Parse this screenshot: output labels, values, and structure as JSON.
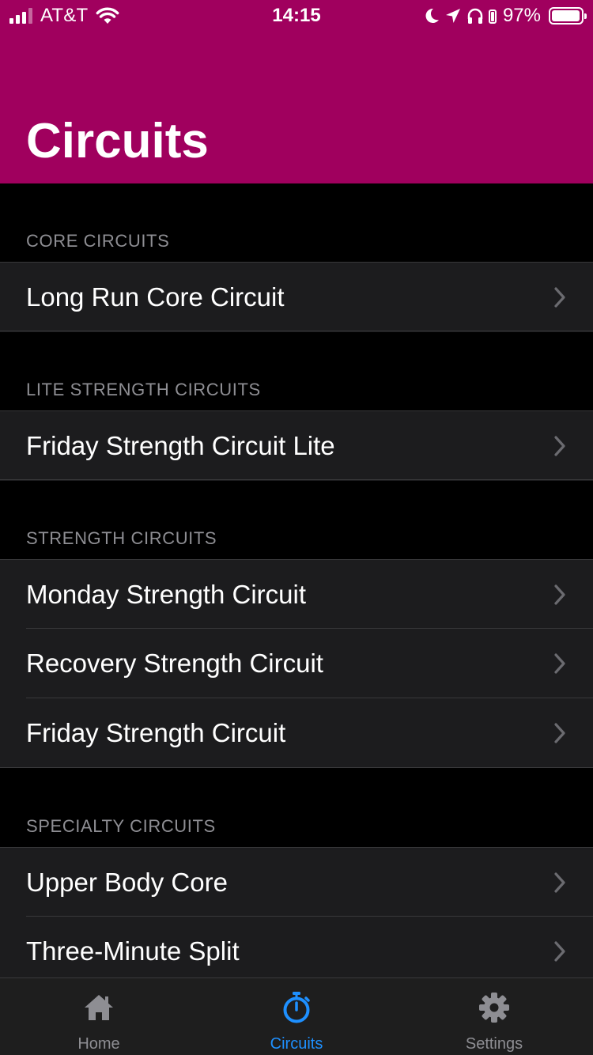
{
  "status_bar": {
    "carrier": "AT&T",
    "time": "14:15",
    "battery_percent": "97%",
    "battery_level": 0.97,
    "icons": [
      "signal-icon",
      "wifi-icon",
      "moon-icon",
      "location-arrow-icon",
      "headphones-icon",
      "battery-icon"
    ]
  },
  "header": {
    "title": "Circuits",
    "background_color": "#a0005e"
  },
  "sections": [
    {
      "title": "CORE CIRCUITS",
      "items": [
        {
          "label": "Long Run Core Circuit"
        }
      ]
    },
    {
      "title": "LITE STRENGTH CIRCUITS",
      "items": [
        {
          "label": "Friday Strength Circuit Lite"
        }
      ]
    },
    {
      "title": "STRENGTH CIRCUITS",
      "items": [
        {
          "label": "Monday Strength Circuit"
        },
        {
          "label": "Recovery Strength Circuit"
        },
        {
          "label": "Friday Strength Circuit"
        }
      ]
    },
    {
      "title": "SPECIALTY CIRCUITS",
      "items": [
        {
          "label": "Upper Body Core"
        },
        {
          "label": "Three-Minute Split"
        }
      ]
    }
  ],
  "tabbar": {
    "tabs": [
      {
        "label": "Home",
        "icon": "home-icon",
        "active": false
      },
      {
        "label": "Circuits",
        "icon": "stopwatch-icon",
        "active": true
      },
      {
        "label": "Settings",
        "icon": "gear-icon",
        "active": false
      }
    ],
    "active_color": "#1e90ff",
    "inactive_color": "#8e8e93"
  }
}
